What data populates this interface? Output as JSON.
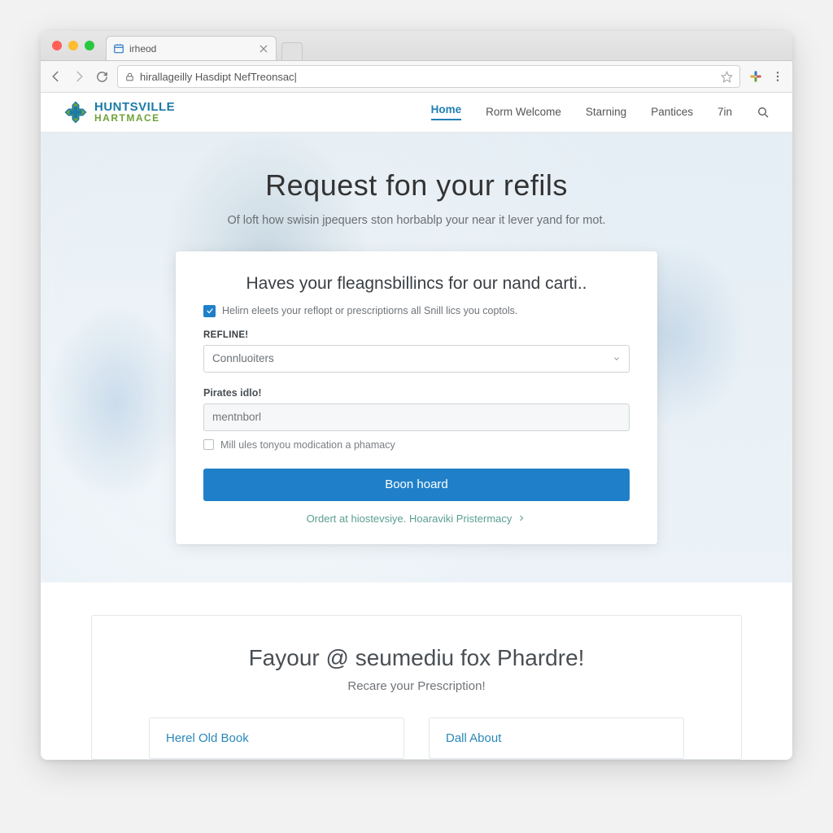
{
  "browser": {
    "tab_title": "irheod",
    "url": "hirallageilly Hasdipt NefTreonsac|"
  },
  "site": {
    "logo_line1": "HUNTSVILLE",
    "logo_line2": "HARTMACE",
    "nav": {
      "home": "Home",
      "welcome": "Rorm Welcome",
      "starning": "Starning",
      "pantices": "Pantices",
      "tin": "7in"
    }
  },
  "hero": {
    "title": "Request fon your refils",
    "subtitle": "Of loft how swisin jpequers ston horbablp your near it lever yand for mot."
  },
  "form": {
    "heading": "Haves your fleagnsbillincs for our nand carti..",
    "check_text": "Helirn eleets your reflopt or prescriptiorns all Snill lics you coptols.",
    "select_label": "REFLINE!",
    "select_value": "Connluoiters",
    "input_label": "Pirates idlo!",
    "input_placeholder": "mentnborl",
    "option_text": "Mill ules tonyou modication a phamacy",
    "submit": "Boon hoard",
    "alt_link": "Ordert at hiostevsiye. Hoaraviki Pristermacy"
  },
  "section2": {
    "heading": "Fayour @ seumediu fox Phardre!",
    "subheading": "Recare your Prescription!",
    "col1": "Herel Old Book",
    "col2": "Dall About"
  }
}
